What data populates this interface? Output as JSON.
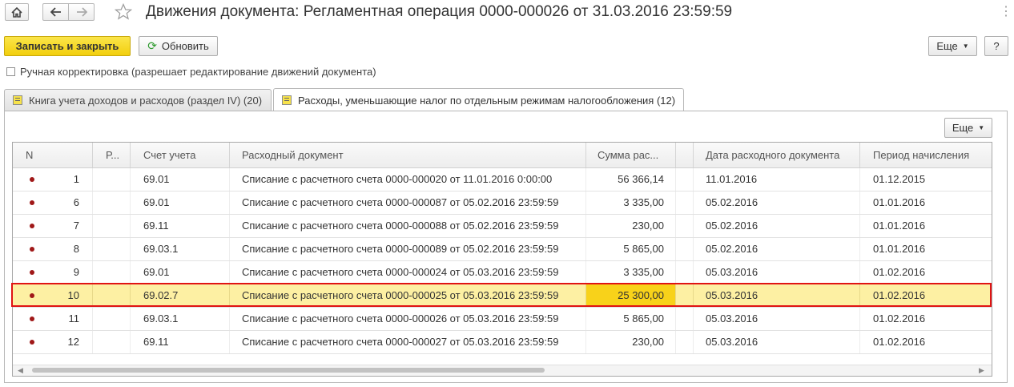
{
  "window": {
    "title": "Движения документа: Регламентная операция 0000-000026 от 31.03.2016 23:59:59"
  },
  "toolbar": {
    "save_close_label": "Записать и закрыть",
    "refresh_label": "Обновить",
    "more_label": "Еще",
    "help_label": "?"
  },
  "manual_correction": {
    "label": "Ручная корректировка (разрешает редактирование движений документа)",
    "checked": false
  },
  "tabs": [
    {
      "label": "Книга учета доходов и расходов (раздел IV) (20)",
      "active": false
    },
    {
      "label": "Расходы, уменьшающие налог по отдельным режимам налогообложения (12)",
      "active": true
    }
  ],
  "table": {
    "more_label": "Еще",
    "columns": [
      "N",
      "Р...",
      "Счет учета",
      "Расходный документ",
      "Сумма рас...",
      "",
      "Дата расходного документа",
      "Период начисления"
    ],
    "rows": [
      {
        "n": "1",
        "r": "",
        "account": "69.01",
        "doc": "Списание с расчетного счета 0000-000020 от 11.01.2016 0:00:00",
        "sum": "56 366,14",
        "date": "11.01.2016",
        "period": "01.12.2015",
        "selected": false
      },
      {
        "n": "6",
        "r": "",
        "account": "69.01",
        "doc": "Списание с расчетного счета 0000-000087 от 05.02.2016 23:59:59",
        "sum": "3 335,00",
        "date": "05.02.2016",
        "period": "01.01.2016",
        "selected": false
      },
      {
        "n": "7",
        "r": "",
        "account": "69.11",
        "doc": "Списание с расчетного счета 0000-000088 от 05.02.2016 23:59:59",
        "sum": "230,00",
        "date": "05.02.2016",
        "period": "01.01.2016",
        "selected": false
      },
      {
        "n": "8",
        "r": "",
        "account": "69.03.1",
        "doc": "Списание с расчетного счета 0000-000089 от 05.02.2016 23:59:59",
        "sum": "5 865,00",
        "date": "05.02.2016",
        "period": "01.01.2016",
        "selected": false
      },
      {
        "n": "9",
        "r": "",
        "account": "69.01",
        "doc": "Списание с расчетного счета 0000-000024 от 05.03.2016 23:59:59",
        "sum": "3 335,00",
        "date": "05.03.2016",
        "period": "01.02.2016",
        "selected": false
      },
      {
        "n": "10",
        "r": "",
        "account": "69.02.7",
        "doc": "Списание с расчетного счета 0000-000025 от 05.03.2016 23:59:59",
        "sum": "25 300,00",
        "date": "05.03.2016",
        "period": "01.02.2016",
        "selected": true
      },
      {
        "n": "11",
        "r": "",
        "account": "69.03.1",
        "doc": "Списание с расчетного счета 0000-000026 от 05.03.2016 23:59:59",
        "sum": "5 865,00",
        "date": "05.03.2016",
        "period": "01.02.2016",
        "selected": false
      },
      {
        "n": "12",
        "r": "",
        "account": "69.11",
        "doc": "Списание с расчетного счета 0000-000027 от 05.03.2016 23:59:59",
        "sum": "230,00",
        "date": "05.03.2016",
        "period": "01.02.2016",
        "selected": false
      }
    ]
  },
  "icons": {
    "home": "home-icon",
    "back": "arrow-left-icon",
    "forward": "arrow-right-icon",
    "favorite": "star-icon",
    "close": "close-icon",
    "refresh": "refresh-icon",
    "row_marker": "record-dot-icon"
  },
  "colors": {
    "primary_button": "#f5d415",
    "selected_row": "#fdf0a3",
    "selected_cell": "#f8d21a",
    "highlight_frame": "#e01414",
    "row_dot": "#a01818"
  }
}
